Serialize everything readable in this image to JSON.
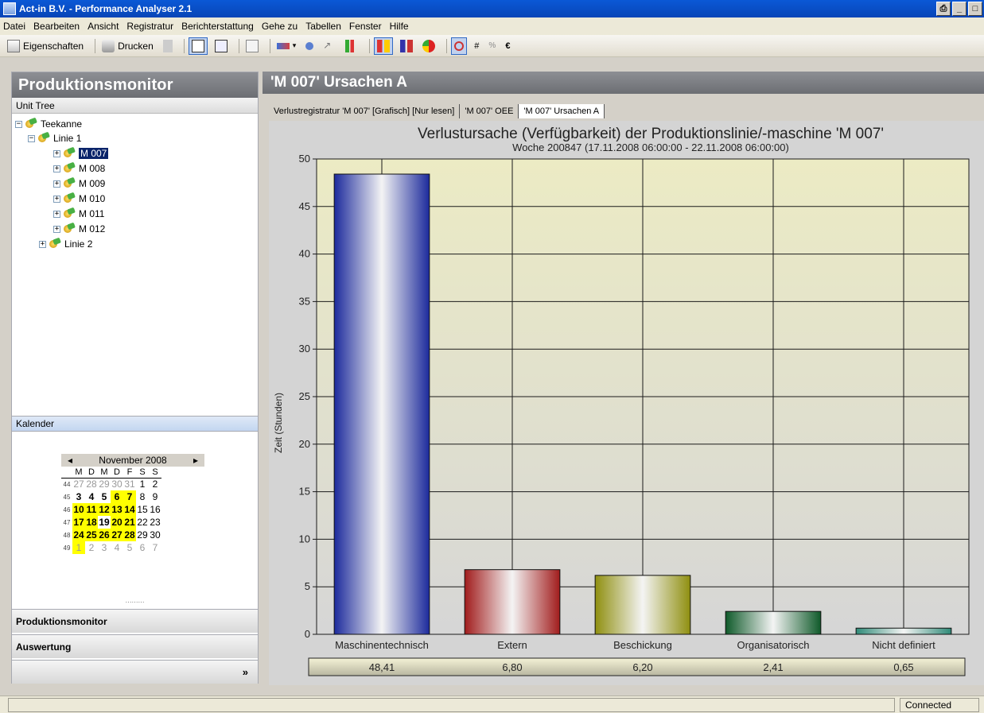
{
  "window": {
    "title": "Act-in B.V. - Performance Analyser 2.1"
  },
  "menu": [
    "Datei",
    "Bearbeiten",
    "Ansicht",
    "Registratur",
    "Berichterstattung",
    "Gehe zu",
    "Tabellen",
    "Fenster",
    "Hilfe"
  ],
  "toolbar": {
    "properties_label": "Eigenschaften",
    "print_label": "Drucken"
  },
  "left": {
    "header": "Produktionsmonitor",
    "unit_tree_label": "Unit Tree",
    "tree": {
      "root": "Teekanne",
      "line1": "Linie 1",
      "machines": [
        "M 007",
        "M 008",
        "M 009",
        "M 010",
        "M 011",
        "M 012"
      ],
      "line2": "Linie 2"
    },
    "calendar_label": "Kalender",
    "calendar": {
      "month_label": "November 2008",
      "weekdays": [
        "M",
        "D",
        "M",
        "D",
        "F",
        "S",
        "S"
      ],
      "weeks": [
        {
          "wk": "44",
          "days": [
            "27",
            "28",
            "29",
            "30",
            "31",
            "1",
            "2"
          ]
        },
        {
          "wk": "45",
          "days": [
            "3",
            "4",
            "5",
            "6",
            "7",
            "8",
            "9"
          ]
        },
        {
          "wk": "46",
          "days": [
            "10",
            "11",
            "12",
            "13",
            "14",
            "15",
            "16"
          ]
        },
        {
          "wk": "47",
          "days": [
            "17",
            "18",
            "19",
            "20",
            "21",
            "22",
            "23"
          ]
        },
        {
          "wk": "48",
          "days": [
            "24",
            "25",
            "26",
            "27",
            "28",
            "29",
            "30"
          ]
        },
        {
          "wk": "49",
          "days": [
            "1",
            "2",
            "3",
            "4",
            "5",
            "6",
            "7"
          ]
        }
      ]
    },
    "nav": {
      "monitor": "Produktionsmonitor",
      "evaluation": "Auswertung",
      "more": "»"
    }
  },
  "right": {
    "header": "'M 007' Ursachen A",
    "tabs": [
      "Verlustregistratur 'M 007' [Grafisch] [Nur lesen]",
      "'M 007' OEE",
      "'M 007' Ursachen A"
    ],
    "active_tab": 2
  },
  "chart_data": {
    "type": "bar",
    "title": "Verlustursache (Verfügbarkeit) der Produktionslinie/-maschine 'M 007'",
    "subtitle": "Woche 200847 (17.11.2008 06:00:00 - 22.11.2008 06:00:00)",
    "ylabel": "Zeit (Stunden)",
    "xlabel": "",
    "ylim": [
      0,
      50
    ],
    "yticks": [
      0,
      5,
      10,
      15,
      20,
      25,
      30,
      35,
      40,
      45,
      50
    ],
    "grid": true,
    "categories": [
      "Maschinentechnisch",
      "Extern",
      "Beschickung",
      "Organisatorisch",
      "Nicht definiert"
    ],
    "values": [
      48.41,
      6.8,
      6.2,
      2.41,
      0.65
    ],
    "value_labels": [
      "48,41",
      "6,80",
      "6,20",
      "2,41",
      "0,65"
    ],
    "colors": [
      "#1c2a9c",
      "#a11c1c",
      "#8f8f0f",
      "#0f5a2a",
      "#2f8a78"
    ]
  },
  "status": {
    "connection": "Connected"
  }
}
